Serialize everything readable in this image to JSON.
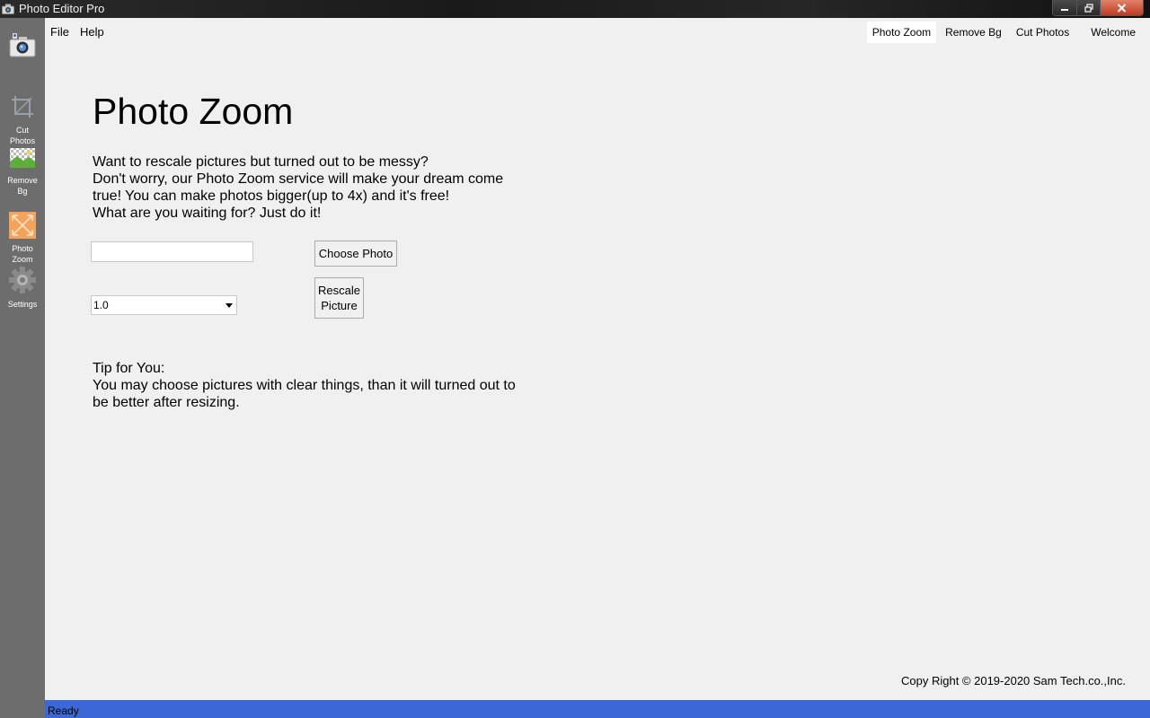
{
  "window": {
    "title": "Photo Editor Pro"
  },
  "menubar": {
    "items": [
      "File",
      "Help"
    ]
  },
  "nav_tabs": [
    {
      "label": "Photo Zoom",
      "active": true
    },
    {
      "label": "Remove Bg",
      "active": false
    },
    {
      "label": "Cut Photos",
      "active": false
    },
    {
      "label": "Welcome",
      "active": false
    }
  ],
  "sidebar": {
    "items": [
      {
        "icon": "camera-icon",
        "label": ""
      },
      {
        "icon": "crop-icon",
        "label_lines": [
          "Cut",
          "Photos"
        ]
      },
      {
        "icon": "image-transparent-icon",
        "label_lines": [
          "Remove",
          "Bg"
        ]
      },
      {
        "icon": "zoom-arrows-icon",
        "label_lines": [
          "Photo",
          "Zoom"
        ],
        "active": true
      },
      {
        "icon": "gear-icon",
        "label_lines": [
          "Settings"
        ]
      }
    ]
  },
  "main": {
    "title": "Photo Zoom",
    "description": [
      "Want to rescale pictures but turned out to be messy?",
      "Don't worry, our Photo Zoom service will make your dream come",
      "true! You can make photos bigger(up to 4x) and it's free!",
      "What are you waiting for? Just do it!"
    ],
    "path_input": {
      "value": "",
      "placeholder": ""
    },
    "choose_button": "Choose Photo",
    "scale_select": {
      "value": "1.0"
    },
    "rescale_button": [
      "Rescale",
      "Picture"
    ],
    "tip": [
      "Tip for You:",
      "You may choose pictures with clear things, than it will turned out to",
      "be better after resizing."
    ]
  },
  "footer": {
    "copyright": "Copy Right © 2019-2020 Sam Tech.co.,Inc."
  },
  "statusbar": {
    "text": "Ready"
  },
  "colors": {
    "sidebar": "#6d6d6d",
    "statusbar": "#3b68d6",
    "background": "#f0f0f0",
    "active_icon": "#f5a35a"
  }
}
